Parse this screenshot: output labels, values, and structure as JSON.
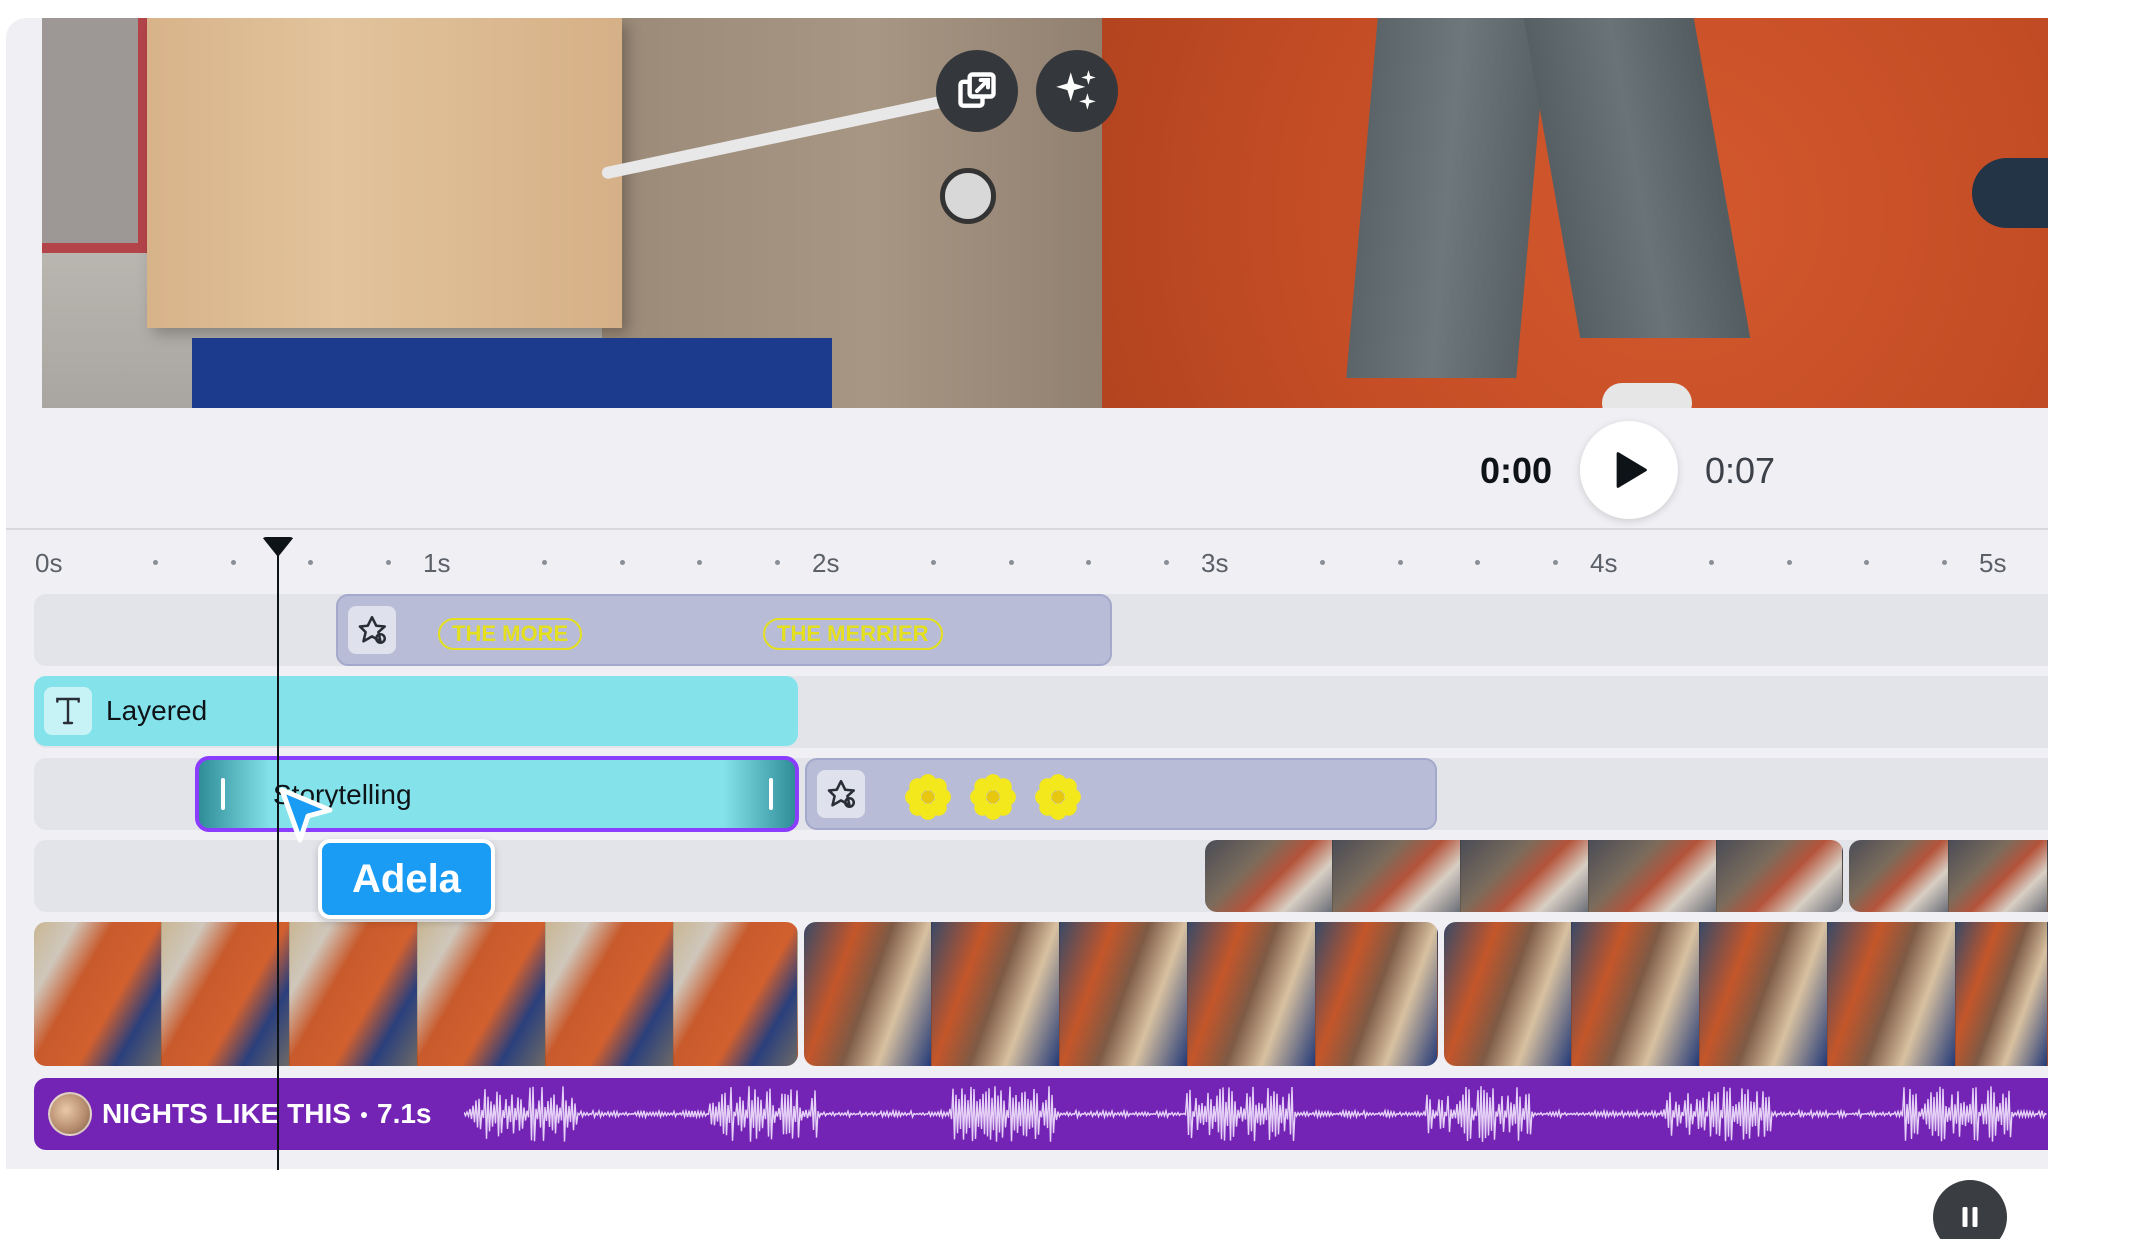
{
  "preview": {
    "open_in_new_icon": "open-in-new-icon",
    "magic_icon": "sparkles-icon"
  },
  "playback": {
    "current_time": "0:00",
    "total_time": "0:07",
    "play_icon": "play-icon"
  },
  "ruler": {
    "labels": [
      "0s",
      "1s",
      "2s",
      "3s",
      "4s",
      "5s"
    ]
  },
  "tracks": {
    "graphic_pills": [
      "THE MORE",
      "THE MERRIER"
    ],
    "text_clip_label": "Layered",
    "selected_clip_label": "Storytelling",
    "graphic_icon": "shapes-icon",
    "text_icon": "text-icon",
    "flower_icon": "flower-icon"
  },
  "collaborator": {
    "name": "Adela",
    "cursor_color": "#1b9cf4"
  },
  "audio": {
    "title": "NIGHTS LIKE THIS",
    "duration": "7.1s",
    "color": "#7424b4"
  },
  "controls": {
    "pause_icon": "pause-icon"
  },
  "colors": {
    "text_clip": "#84e3ea",
    "graphic_clip": "#b8bcd6",
    "selection": "#8b3dff",
    "accent_yellow": "#e4e01e"
  }
}
